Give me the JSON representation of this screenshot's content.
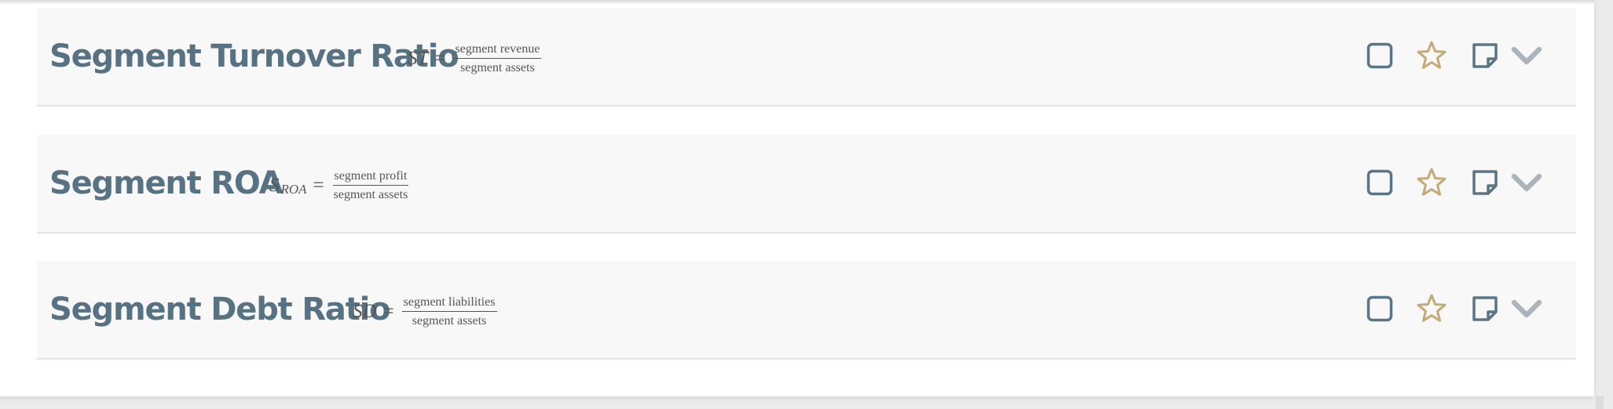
{
  "cards": [
    {
      "title": "Segment Turnover Ratio",
      "formula": {
        "lhs": "ST",
        "sub": "",
        "eq": "=",
        "numerator": "segment revenue",
        "denominator": "segment assets"
      }
    },
    {
      "title": "Segment ROA",
      "formula": {
        "lhs": "S",
        "sub": "ROA",
        "eq": "=",
        "numerator": "segment profit",
        "denominator": "segment assets"
      }
    },
    {
      "title": "Segment Debt Ratio",
      "formula": {
        "lhs": "SD",
        "sub": "",
        "eq": "=",
        "numerator": "segment liabilities",
        "denominator": "segment assets"
      }
    }
  ],
  "icons": {
    "checkbox": "checkbox-icon",
    "star": "star-icon",
    "note": "note-icon",
    "expand": "chevron-down-icon"
  },
  "colors": {
    "title": "#577283",
    "icon": "#5a7585",
    "star": "#c4aa78",
    "chevron": "#a9b4bb",
    "card_background": "#f8f8f8"
  }
}
